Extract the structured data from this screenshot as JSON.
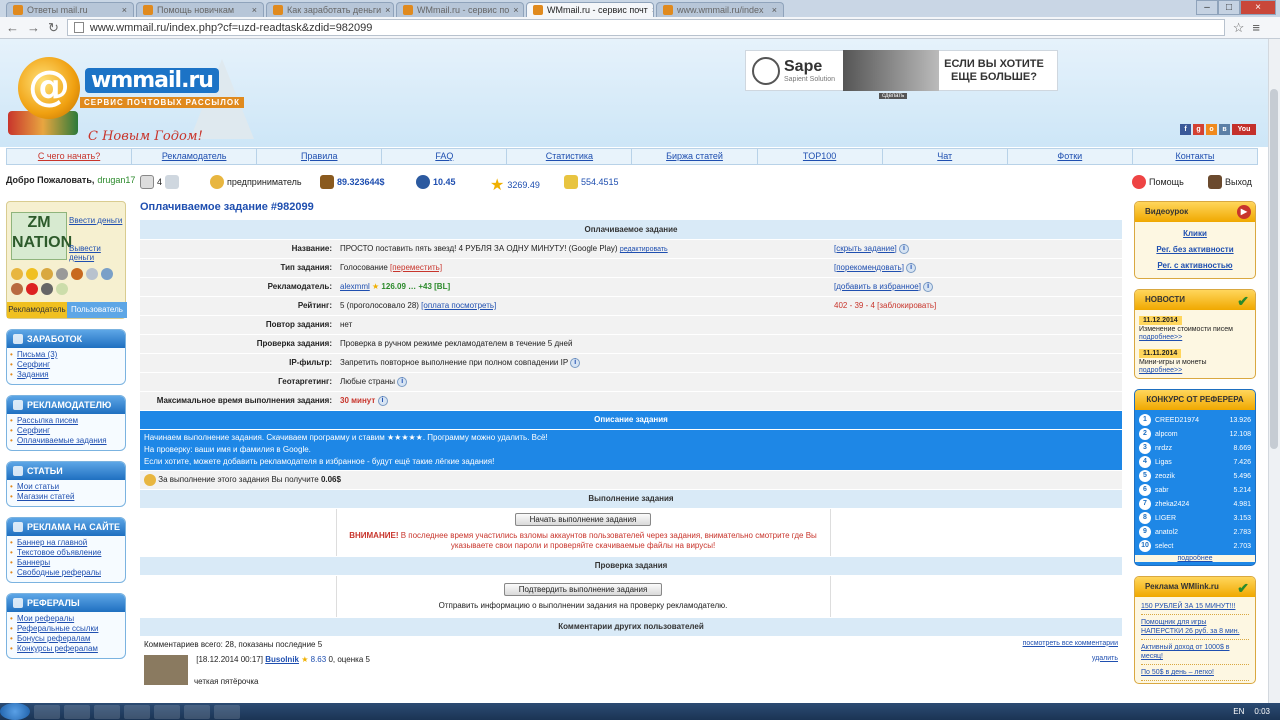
{
  "browser": {
    "tabs": [
      {
        "label": "Ответы mail.ru"
      },
      {
        "label": "Помощь новичкам"
      },
      {
        "label": "Как заработать деньги"
      },
      {
        "label": "WMmail.ru - сервис по"
      },
      {
        "label": "WMmail.ru - сервис почт",
        "active": true
      },
      {
        "label": "www.wmmail.ru/index"
      }
    ],
    "url": "www.wmmail.ru/index.php?cf=uzd-readtask&zdid=982099"
  },
  "banner": {
    "logo_text": "wmmail.ru",
    "logo_sub": "СЕРВИС ПОЧТОВЫХ РАССЫЛОК",
    "greeting": "С Новым Годом!",
    "ad": {
      "brand": "Sape",
      "brand_sub": "Sapient Solution",
      "caption": "сделать",
      "text": "ЕСЛИ ВЫ ХОТИТЕ ЕЩЕ БОЛЬШЕ?"
    }
  },
  "menu": [
    "С чего начать?",
    "Рекламодатель",
    "Правила",
    "FAQ",
    "Статистика",
    "Биржа статей",
    "TOP100",
    "Чат",
    "Фотки",
    "Контакты"
  ],
  "userbar": {
    "welcome": "Добро Пожаловать,",
    "username": "drugan17",
    "mail_count": "4",
    "status": "предприниматель",
    "balance": "89.323644$",
    "rating": "10.45",
    "stars": "3269.49",
    "coins": "554.4515",
    "help": "Помощь",
    "exit": "Выход"
  },
  "zm": {
    "logo": "ZM NATION",
    "deposit": "Ввести деньги",
    "withdraw": "Вывести деньги",
    "tab_adv": "Рекламодатель",
    "tab_user": "Пользователь"
  },
  "left_sections": [
    {
      "title": "ЗАРАБОТОК",
      "items": [
        "Письма (3)",
        "Серфинг",
        "Задания"
      ]
    },
    {
      "title": "РЕКЛАМОДАТЕЛЮ",
      "items": [
        "Рассылка писем",
        "Серфинг",
        "Оплачиваемые задания"
      ]
    },
    {
      "title": "СТАТЬИ",
      "items": [
        "Мои статьи",
        "Магазин статей"
      ]
    },
    {
      "title": "РЕКЛАМА НА САЙТЕ",
      "items": [
        "Баннер на главной",
        "Текстовое объявление",
        "Баннеры",
        "Свободные рефералы"
      ]
    },
    {
      "title": "РЕФЕРАЛЫ",
      "items": [
        "Мои рефералы",
        "Реферальные ссылки",
        "Бонусы рефералам",
        "Конкурсы рефералам"
      ]
    }
  ],
  "task": {
    "title": "Оплачиваемое задание #982099",
    "section_header": "Оплачиваемое задание",
    "rows": [
      {
        "label": "Название:",
        "value": "ПРОСТО поставить пять звезд! 4 РУБЛЯ ЗА ОДНУ МИНУТУ! (Google Play)",
        "value_link": "редактировать",
        "right": "[скрыть задание]"
      },
      {
        "label": "Тип задания:",
        "value": "Голосование",
        "value_link": "[переместить]",
        "right": "[порекомендовать]"
      },
      {
        "label": "Рекламодатель:",
        "value": "alexmml",
        "value_link": "126.09 … +43 [BL]",
        "right": "[добавить в избранное]"
      },
      {
        "label": "Рейтинг:",
        "value": "5 (проголосовало 28)",
        "value_link": "[оплата посмотреть]",
        "right": "402 - 39 - 4 [заблокировать]"
      },
      {
        "label": "Повтор задания:",
        "value": "нет",
        "value_link": "",
        "right": ""
      },
      {
        "label": "Проверка задания:",
        "value": "Проверка в ручном режиме рекламодателем в течение 5 дней",
        "value_link": "",
        "right": ""
      },
      {
        "label": "IP-фильтр:",
        "value": "Запретить повторное выполнение при полном совпадении IP",
        "value_link": "",
        "right": ""
      },
      {
        "label": "Геотаргетинг:",
        "value": "Любые страны",
        "value_link": "",
        "right": ""
      },
      {
        "label": "Максимальное время выполнения задания:",
        "value": "30 минут",
        "value_link": "",
        "right": ""
      }
    ],
    "description_header": "Описание задания",
    "description": [
      "Начинаем выполнение задания. Скачиваем программу и ставим ★★★★★. Программу можно удалить. Всё!",
      "На проверку: ваши имя и фамилия в Google.",
      "Если хотите, можете добавить рекламодателя в избранное - будут ещё такие лёгкие задания!"
    ],
    "reward_text": "За выполнение этого задания Вы получите",
    "reward_value": "0.06$",
    "exec_header": "Выполнение задания",
    "start_button": "Начать выполнение задания",
    "warning_bold": "ВНИМАНИЕ!",
    "warning": "В последнее время участились взломы аккаунтов пользователей через задания, внимательно смотрите где Вы указываете свои пароли и проверяйте скачиваемые файлы на вирусы!",
    "check_header": "Проверка задания",
    "confirm_button": "Подтвердить выполнение задания",
    "confirm_note": "Отправить информацию о выполнении задания на проверку рекламодателю.",
    "comments_header": "Комментарии других пользователей",
    "comments_total": "Комментариев всего: 28, показаны последние 5",
    "comments_all": "посмотреть все комментарии",
    "comment": {
      "date": "[18.12.2014 00:17]",
      "user": "Busolnik",
      "score": "8.63",
      "mark": "0, оценка 5",
      "delete": "удалить",
      "text": "четкая пятёрочка"
    }
  },
  "right": {
    "video_title": "Видеоурок",
    "video_links": [
      "Клики",
      "Рег. без активности",
      "Рег. с активностью"
    ],
    "news_title": "НОВОСТИ",
    "news": [
      {
        "date": "11.12.2014",
        "text": "Изменение стоимости писем",
        "more": "подробнее>>"
      },
      {
        "date": "11.11.2014",
        "text": "Мини-игры и монеты",
        "more": "подробнее>>"
      }
    ],
    "contest_title": "КОНКУРС ОТ РЕФЕРЕРА",
    "contest": [
      {
        "n": "1",
        "name": "CREED21974",
        "val": "13.926"
      },
      {
        "n": "2",
        "name": "alpcom",
        "val": "12.108"
      },
      {
        "n": "3",
        "name": "nrdzz",
        "val": "8.669"
      },
      {
        "n": "4",
        "name": "Ligas",
        "val": "7.426"
      },
      {
        "n": "5",
        "name": "zeozik",
        "val": "5.496"
      },
      {
        "n": "6",
        "name": "sabr",
        "val": "5.214"
      },
      {
        "n": "7",
        "name": "zheka2424",
        "val": "4.981"
      },
      {
        "n": "8",
        "name": "LIGER",
        "val": "3.153"
      },
      {
        "n": "9",
        "name": "anatol2",
        "val": "2.783"
      },
      {
        "n": "10",
        "name": "select",
        "val": "2.703"
      }
    ],
    "contest_more": "подробнее",
    "ads_title": "Реклама WMlink.ru",
    "ads": [
      "150 РУБЛЕЙ ЗА 15 МИНУТ!!!",
      "Помощник для игры НАПЕРСТКИ 26 руб. за 8 мин.",
      "Активный доход от 1000$ в месяц!",
      "По 50$ в день – легко!"
    ]
  },
  "taskbar": {
    "lang": "EN",
    "time": "0:03"
  }
}
